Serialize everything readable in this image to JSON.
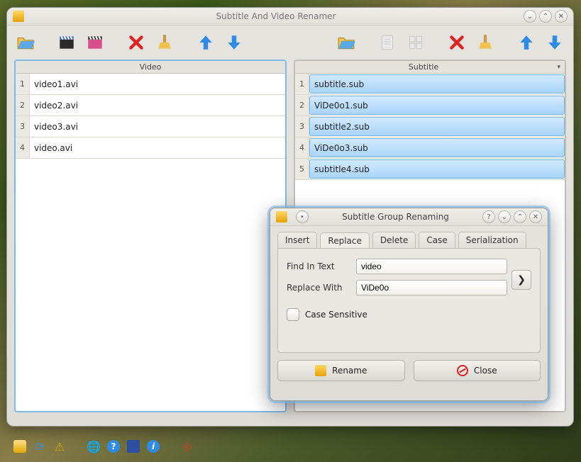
{
  "window": {
    "title": "Subtitle And Video Renamer"
  },
  "panels": {
    "video": {
      "title": "Video"
    },
    "subtitle": {
      "title": "Subtitle"
    }
  },
  "video_list": [
    {
      "idx": "1",
      "name": "video1.avi"
    },
    {
      "idx": "2",
      "name": "video2.avi"
    },
    {
      "idx": "3",
      "name": "video3.avi"
    },
    {
      "idx": "4",
      "name": "video.avi"
    }
  ],
  "subtitle_list": [
    {
      "idx": "1",
      "name": "subtitle.sub"
    },
    {
      "idx": "2",
      "name": "ViDe0o1.sub"
    },
    {
      "idx": "3",
      "name": "subtitle2.sub"
    },
    {
      "idx": "4",
      "name": "ViDe0o3.sub"
    },
    {
      "idx": "5",
      "name": "subtitle4.sub"
    }
  ],
  "dialog": {
    "title": "Subtitle Group Renaming",
    "tabs": {
      "insert": "Insert",
      "replace": "Replace",
      "delete": "Delete",
      "case": "Case",
      "serialization": "Serialization"
    },
    "labels": {
      "find": "Find In Text",
      "replace": "Replace With",
      "case_sensitive": "Case Sensitive"
    },
    "values": {
      "find": "video",
      "replace": "ViDe0o"
    },
    "buttons": {
      "rename": "Rename",
      "close": "Close"
    }
  }
}
